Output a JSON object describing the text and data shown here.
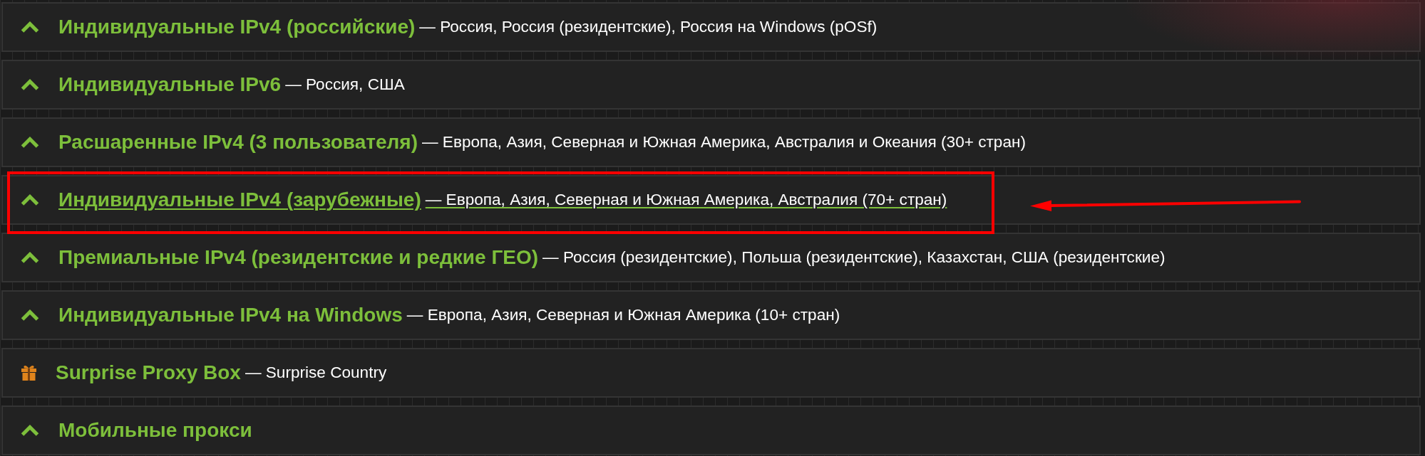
{
  "accordion": {
    "items": [
      {
        "kind": "category",
        "title": "Индивидуальные IPv4 (российские)",
        "countries": "— Россия, Россия (резидентские), Россия на Windows (pOSf)",
        "hovered": false,
        "highlighted": false
      },
      {
        "kind": "category",
        "title": "Индивидуальные IPv6",
        "countries": "— Россия, США",
        "hovered": false,
        "highlighted": false
      },
      {
        "kind": "category",
        "title": "Расшаренные IPv4 (3 пользователя)",
        "countries": "— Европа, Азия, Северная и Южная Америка, Австралия и Океания (30+ стран)",
        "hovered": false,
        "highlighted": false
      },
      {
        "kind": "category",
        "title": "Индивидуальные IPv4 (зарубежные)",
        "countries": "— Европа, Азия, Северная и Южная Америка, Австралия (70+ стран)",
        "hovered": true,
        "highlighted": true
      },
      {
        "kind": "category",
        "title": "Премиальные IPv4 (резидентские и редкие ГЕО)",
        "countries": "— Россия (резидентские), Польша (резидентские), Казахстан, США (резидентские)",
        "hovered": false,
        "highlighted": false
      },
      {
        "kind": "category",
        "title": "Индивидуальные IPv4 на Windows",
        "countries": "— Европа, Азия, Северная и Южная Америка (10+ стран)",
        "hovered": false,
        "highlighted": false
      },
      {
        "kind": "gift",
        "title": "Surprise Proxy Box",
        "countries": "— Surprise Country",
        "hovered": false,
        "highlighted": false
      },
      {
        "kind": "category",
        "title": "Мобильные прокси",
        "hovered": false,
        "highlighted": false
      }
    ]
  }
}
